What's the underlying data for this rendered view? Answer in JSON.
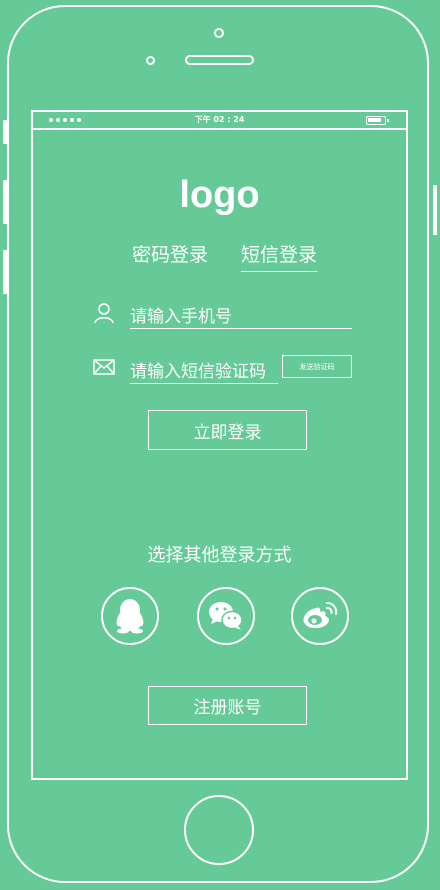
{
  "status_bar": {
    "time": "下午 02 : 24"
  },
  "header": {
    "logo_text": "logo"
  },
  "tabs": [
    {
      "label": "密码登录",
      "active": false
    },
    {
      "label": "短信登录",
      "active": true
    }
  ],
  "form": {
    "phone_placeholder": "请输入手机号",
    "code_placeholder": "请输入短信验证码",
    "send_code_label": "发送验证码",
    "login_label": "立即登录"
  },
  "other_login": {
    "title": "选择其他登录方式",
    "providers": [
      {
        "icon": "qq-icon"
      },
      {
        "icon": "wechat-icon"
      },
      {
        "icon": "weibo-icon"
      }
    ]
  },
  "register_label": "注册账号",
  "colors": {
    "background": "#66c998",
    "foreground": "#ffffff"
  }
}
